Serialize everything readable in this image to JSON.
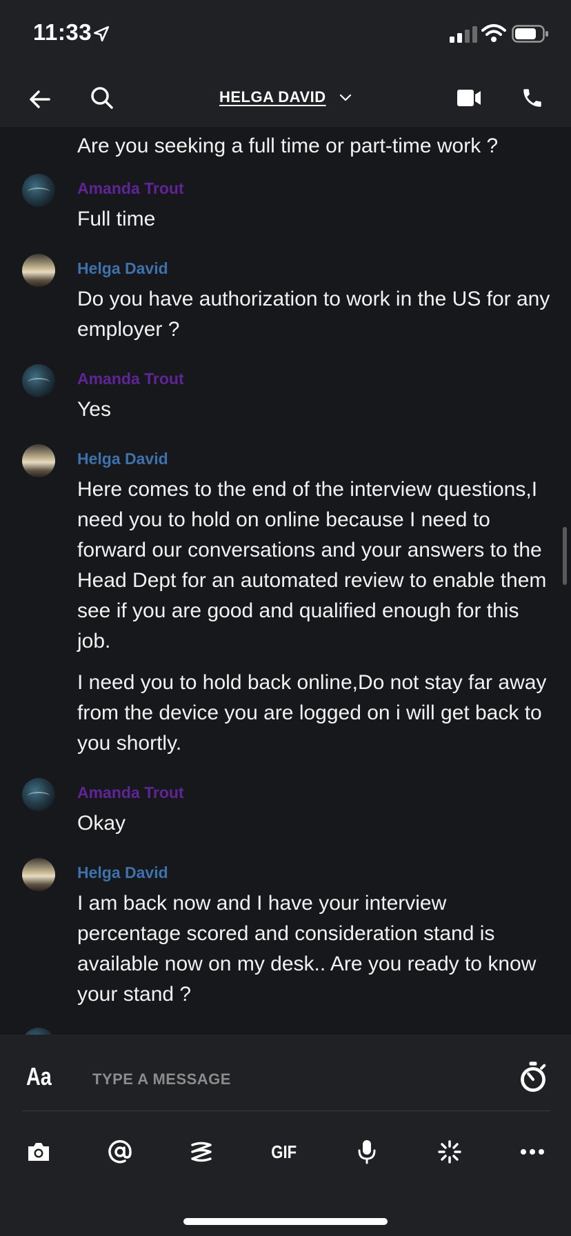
{
  "status_bar": {
    "time": "11:33"
  },
  "header": {
    "title": "HELGA DAVID"
  },
  "messages": [
    {
      "text": "Are you seeking a full time or part-time work ?"
    },
    {
      "sender": "Amanda Trout",
      "text": "Full time"
    },
    {
      "sender": "Helga David",
      "text": "Do you have authorization to work in the US for any employer ?"
    },
    {
      "sender": "Amanda Trout",
      "text": "Yes"
    },
    {
      "sender": "Helga David",
      "text": "Here comes to the end of the interview questions,I need you to hold on online because I need to forward our conversations and your answers to the Head Dept for an automated review to enable them see if you are good and qualified enough for this job.",
      "text2": "I need you to hold back online,Do not stay far away from the device you are logged on i will get back to you shortly."
    },
    {
      "sender": "Amanda Trout",
      "text": "Okay"
    },
    {
      "sender": "Helga David",
      "text": "I am back now and I have your interview percentage scored and consideration stand is available now on my desk.. Are you ready to know your stand ?"
    }
  ],
  "composer": {
    "format_label": "Aa",
    "placeholder": "TYPE A MESSAGE",
    "tools": [
      "camera-icon",
      "mention-icon",
      "sticker-icon",
      "GIF",
      "microphone-icon",
      "sparkle-icon",
      "more-icon"
    ]
  },
  "colors": {
    "background": "#17181b",
    "bar": "#202124",
    "amanda_name": "#5f2597",
    "helga_name": "#3d72ad"
  }
}
